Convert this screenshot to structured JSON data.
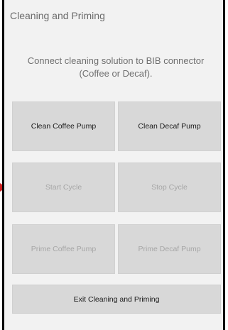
{
  "screen": {
    "title": "Cleaning and Priming",
    "instruction": "Connect cleaning solution to BIB connector (Coffee or Decaf)."
  },
  "buttons": {
    "clean_coffee": "Clean Coffee Pump",
    "clean_decaf": "Clean Decaf Pump",
    "start_cycle": "Start Cycle",
    "stop_cycle": "Stop Cycle",
    "prime_coffee": "Prime Coffee Pump",
    "prime_decaf": "Prime Decaf Pump",
    "exit": "Exit Cleaning and Priming"
  },
  "colors": {
    "panel_bg": "#f2f2f2",
    "button_bg": "#d8d8d8",
    "enabled_text": "#1a1a1a",
    "disabled_text": "#a6a6a6",
    "pointer": "#cc1f1f"
  },
  "icons": {
    "pointer": "arrow-right-icon"
  }
}
